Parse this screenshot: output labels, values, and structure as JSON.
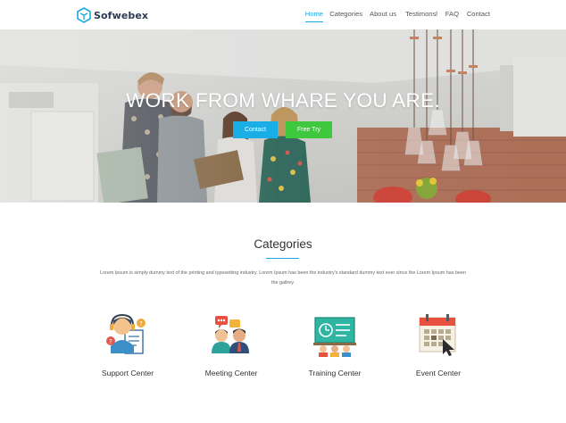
{
  "brand": {
    "name": "Sofwebex"
  },
  "nav": {
    "items": [
      "Home",
      "Categories",
      "About us",
      "Testimonsl",
      "FAQ",
      "Contact"
    ],
    "active": "Home"
  },
  "hero": {
    "title": "WORK FROM WHARE YOU ARE.",
    "contact_label": "Contact",
    "try_label": "Free Try"
  },
  "categories": {
    "title": "Categories",
    "description": "Lorem Ipsum is simply dummy text of the printing and typesetting industry. Lorem Ipsum has been the industry's standard dummy text ever since the Lorem Ipsum has been the gallrey.",
    "items": [
      {
        "label": "Support Center",
        "icon": "support-center-icon"
      },
      {
        "label": "Meeting Center",
        "icon": "meeting-center-icon"
      },
      {
        "label": "Training Center",
        "icon": "training-center-icon"
      },
      {
        "label": "Event Center",
        "icon": "event-center-icon"
      }
    ]
  },
  "colors": {
    "accent": "#1aa9e0",
    "contact_button": "#19aee6",
    "try_button": "#3ec83e",
    "brand_text": "#2b3a55"
  }
}
